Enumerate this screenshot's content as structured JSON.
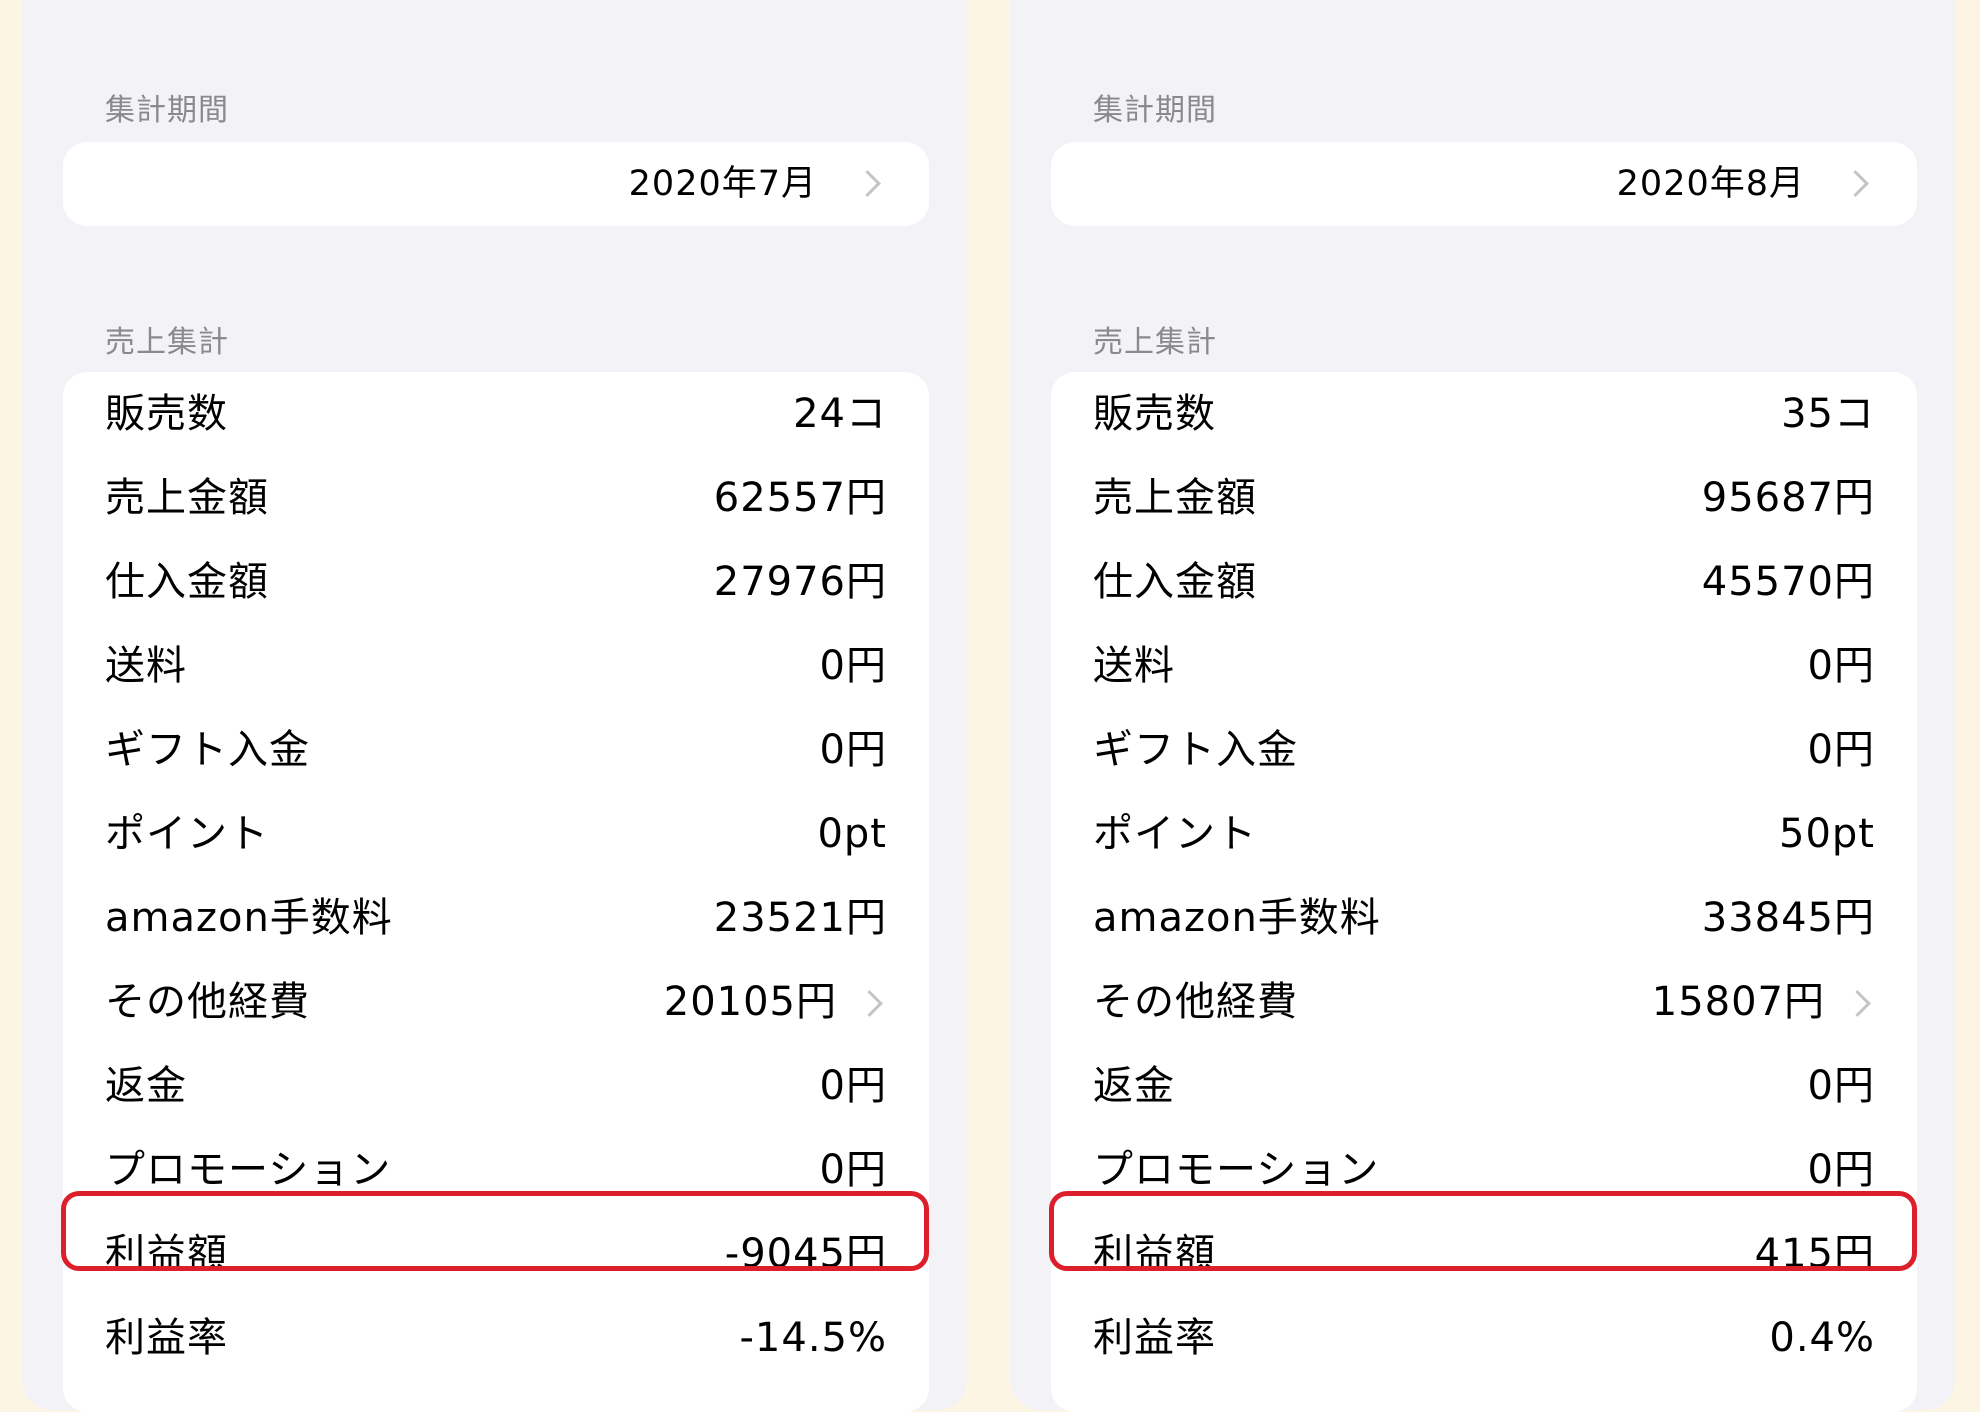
{
  "panels": [
    {
      "period_label": "集計期間",
      "period_value": "2020年7月",
      "sales_label": "売上集計",
      "rows": [
        {
          "label": "販売数",
          "value": "24コ"
        },
        {
          "label": "売上金額",
          "value": "62557円"
        },
        {
          "label": "仕入金額",
          "value": "27976円"
        },
        {
          "label": "送料",
          "value": "0円"
        },
        {
          "label": "ギフト入金",
          "value": "0円"
        },
        {
          "label": "ポイント",
          "value": "0pt"
        },
        {
          "label": "amazon手数料",
          "value": "23521円"
        },
        {
          "label": "その他経費",
          "value": "20105円"
        },
        {
          "label": "返金",
          "value": "0円"
        },
        {
          "label": "プロモーション",
          "value": "0円"
        },
        {
          "label": "利益額",
          "value": "-9045円"
        },
        {
          "label": "利益率",
          "value": "-14.5%"
        }
      ]
    },
    {
      "period_label": "集計期間",
      "period_value": "2020年8月",
      "sales_label": "売上集計",
      "rows": [
        {
          "label": "販売数",
          "value": "35コ"
        },
        {
          "label": "売上金額",
          "value": "95687円"
        },
        {
          "label": "仕入金額",
          "value": "45570円"
        },
        {
          "label": "送料",
          "value": "0円"
        },
        {
          "label": "ギフト入金",
          "value": "0円"
        },
        {
          "label": "ポイント",
          "value": "50pt"
        },
        {
          "label": "amazon手数料",
          "value": "33845円"
        },
        {
          "label": "その他経費",
          "value": "15807円"
        },
        {
          "label": "返金",
          "value": "0円"
        },
        {
          "label": "プロモーション",
          "value": "0円"
        },
        {
          "label": "利益額",
          "value": "415円"
        },
        {
          "label": "利益率",
          "value": "0.4%"
        }
      ]
    }
  ],
  "colors": {
    "page_background": "#fdf5e4",
    "panel_background": "#f2f2f7",
    "card_background": "#ffffff",
    "section_label": "#8a8a8e",
    "chevron": "#c4c4c7",
    "highlight": "#dc1f2b"
  },
  "icons": {
    "period_chevron": "chevron-right-icon",
    "expenses_chevron": "chevron-right-icon"
  }
}
